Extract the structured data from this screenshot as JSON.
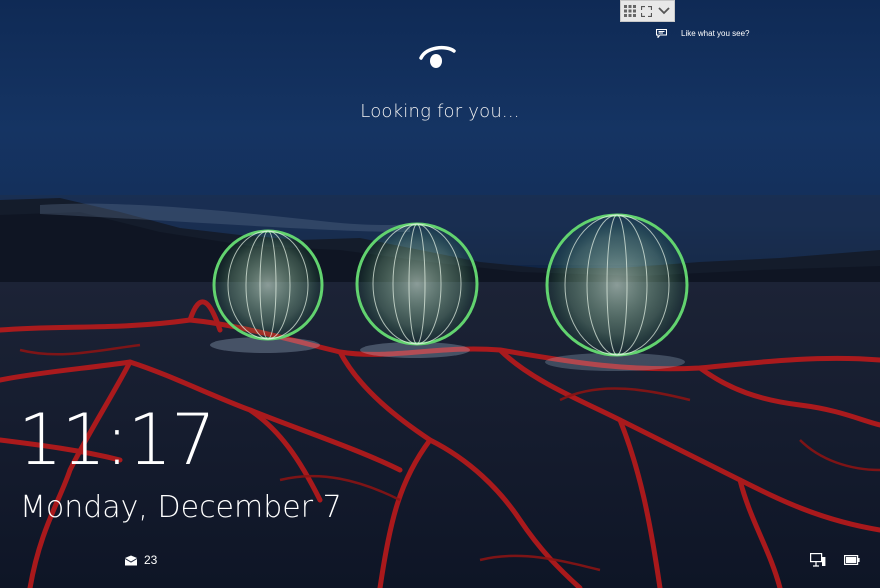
{
  "lockscreen": {
    "status_text": "Looking for you...",
    "time": "11:17",
    "date": "Monday, December 7",
    "feedback_label": "Like what you see?",
    "mail_count": "23"
  },
  "icons": {
    "face_recognition": "windows-hello-face-icon",
    "feedback": "comment-icon",
    "mail": "mail-envelope-icon",
    "network": "network-ethernet-icon",
    "battery": "battery-icon",
    "toolbar": [
      "grid-icon",
      "fullscreen-icon",
      "chevron-down-icon"
    ]
  },
  "colors": {
    "sky_top": "#0f2a55",
    "ground_cracks": "#c41a1a",
    "orb_glow": "#5dcf6c",
    "text": "#ffffff"
  }
}
